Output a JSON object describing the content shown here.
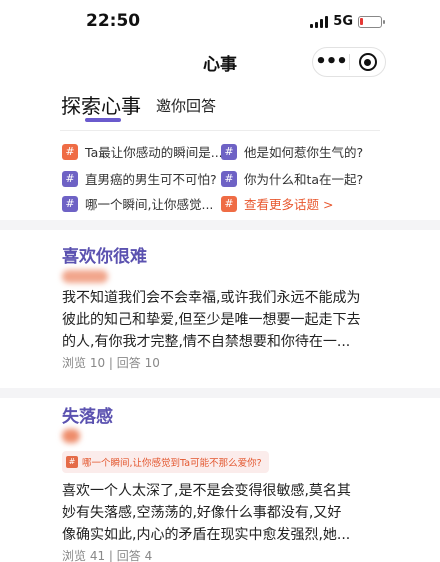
{
  "status": {
    "time": "22:50",
    "network": "5G",
    "battery_level": 0.15,
    "battery_color": "#e53935"
  },
  "navbar": {
    "title": "心事",
    "menu_icon": "more-dots-icon",
    "target_icon": "target-circle-icon"
  },
  "tabs": {
    "active": "探索心事",
    "other": "邀你回答",
    "accent_color": "#6a5acd"
  },
  "topics": [
    {
      "tag": "#",
      "tag_color": "#ef6c45",
      "text": "Ta最让你感动的瞬间是..."
    },
    {
      "tag": "#",
      "tag_color": "#6e62c5",
      "text": "他是如何惹你生气的?"
    },
    {
      "tag": "#",
      "tag_color": "#6e62c5",
      "text": "直男癌的男生可不可怕?"
    },
    {
      "tag": "#",
      "tag_color": "#6e62c5",
      "text": "你为什么和ta在一起?"
    },
    {
      "tag": "#",
      "tag_color": "#6e62c5",
      "text": "哪一个瞬间,让你感觉..."
    },
    {
      "tag": "#",
      "tag_color": "#ef6c45",
      "text": "查看更多话题 >"
    }
  ],
  "cards": [
    {
      "title": "喜欢你很难",
      "body_lines": [
        "我不知道我们会不会幸福,或许我们永远不能成为",
        "彼此的知己和挚爱,但至少是唯一想要一起走下去",
        "的人,有你我才完整,情不自禁想要和你待在一..."
      ],
      "stats": "浏览 10 | 回答 10"
    },
    {
      "title": "失落感",
      "question_tag": "#",
      "question": "哪一个瞬间,让你感觉到Ta可能不那么爱你?",
      "body_lines": [
        "喜欢一个人太深了,是不是会变得很敏感,莫名其",
        "妙有失落感,空荡荡的,好像什么事都没有,又好",
        "像确实如此,内心的矛盾在现实中愈发强烈,她..."
      ],
      "stats": "浏览 41 | 回答 4"
    }
  ]
}
